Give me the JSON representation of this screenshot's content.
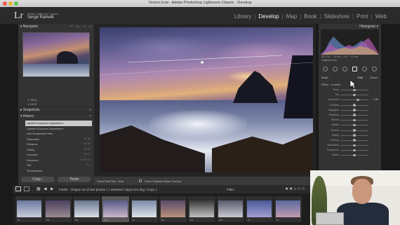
{
  "window": {
    "title": "Venice.lrcat - Adobe Photoshop Lightroom Classic - Develop"
  },
  "identity": {
    "logo": "Lr",
    "subtitle": "Adobe Lightroom Classic",
    "name": "Serge Ramelli"
  },
  "modules": [
    "Library",
    "Develop",
    "Map",
    "Book",
    "Slideshow",
    "Print",
    "Web"
  ],
  "active_module": "Develop",
  "left_panel": {
    "navigator": {
      "title": "Navigator",
      "zoom_options": [
        "FIT",
        "FILL",
        "1:1",
        "1:3"
      ]
    },
    "collection_items": [
      "TEAL",
      "VICE"
    ],
    "snapshots": {
      "title": "Snapshots",
      "add": "+"
    },
    "history": {
      "title": "History",
      "add": "×",
      "items": [
        {
          "label": "Update Exposure Adjustment",
          "amount": "",
          "selected": true
        },
        {
          "label": "Update Exposure Adjustment",
          "amount": ""
        },
        {
          "label": "Add Graduated Filter",
          "amount": ""
        },
        {
          "label": "Saturation",
          "amount": "+16  16"
        },
        {
          "label": "Vibrance",
          "amount": "+25  25"
        },
        {
          "label": "Clarity",
          "amount": "+33  33"
        },
        {
          "label": "Contrast",
          "amount": "+25  25"
        },
        {
          "label": "Exposure",
          "amount": "-0.10  0.10"
        },
        {
          "label": "Tint",
          "amount": "-6  -4"
        },
        {
          "label": "Temperature",
          "amount": ""
        }
      ]
    },
    "copy_label": "Copy...",
    "paste_label": "Paste"
  },
  "toolbar": {
    "show_edit_pins": "Show Edit Pins :",
    "pins_mode": "Auto",
    "overlay_label": "Show Selected Mask Overlay"
  },
  "right_panel": {
    "histogram_title": "Histogram",
    "histogram_info": [
      "ISO 100",
      "24 mm",
      "f/11",
      "0.5 sec"
    ],
    "original_photo": "Original Photo",
    "mask_label": "Mask :",
    "edit_label": "Edit",
    "brush_label": "Brush",
    "effect_label": "Effect :",
    "effect_value": "Custom",
    "sliders": [
      {
        "label": "Temp",
        "value": "",
        "pos": 0.5
      },
      {
        "label": "Tint",
        "value": "",
        "pos": 0.5
      },
      {
        "label": "Exposure",
        "value": "0.90",
        "pos": 0.62
      },
      {
        "label": "Contrast",
        "value": "",
        "pos": 0.5
      },
      {
        "label": "Highlights",
        "value": "",
        "pos": 0.5
      },
      {
        "label": "Shadows",
        "value": "",
        "pos": 0.5
      },
      {
        "label": "Whites",
        "value": "",
        "pos": 0.5
      },
      {
        "label": "Blacks",
        "value": "",
        "pos": 0.5
      },
      {
        "label": "Texture",
        "value": "",
        "pos": 0.5
      },
      {
        "label": "Clarity",
        "value": "",
        "pos": 0.5
      },
      {
        "label": "Dehaze",
        "value": "",
        "pos": 0.5
      },
      {
        "label": "Saturation",
        "value": "",
        "pos": 0.5
      },
      {
        "label": "Sharpness",
        "value": "",
        "pos": 0.5
      },
      {
        "label": "Noise",
        "value": "",
        "pos": 0.5
      }
    ]
  },
  "filmstrip": {
    "path": "Folder : Oregon   10 of 262 photos / 1 selected / day3-124.dng / Copy 1",
    "filter_label": "Filter :",
    "stars": "★★☆☆☆",
    "frames": [
      {
        "dots": "••",
        "colors": [
          "#6a7aa0",
          "#c8ccd8"
        ]
      },
      {
        "dots": "•••",
        "colors": [
          "#4a4060",
          "#9a8a90"
        ]
      },
      {
        "dots": "•••",
        "colors": [
          "#6a7890",
          "#d8dce4"
        ]
      },
      {
        "dots": "••••",
        "colors": [
          "#5a5a8a",
          "#c8b8c8"
        ],
        "selected": true
      },
      {
        "dots": "••",
        "colors": [
          "#7a8aa8",
          "#dfe3ea"
        ]
      },
      {
        "dots": "•••",
        "colors": [
          "#5a4a6a",
          "#b8907a"
        ]
      },
      {
        "dots": "•••",
        "colors": [
          "#3a3a3a",
          "#c0c0c0"
        ]
      },
      {
        "dots": "••••",
        "colors": [
          "#5a5a70",
          "#c8c8d0"
        ]
      },
      {
        "dots": "••",
        "colors": [
          "#4a5a9a",
          "#a0a0d0"
        ]
      },
      {
        "dots": "••",
        "colors": [
          "#5a6aa0",
          "#c09ab0"
        ]
      }
    ]
  }
}
